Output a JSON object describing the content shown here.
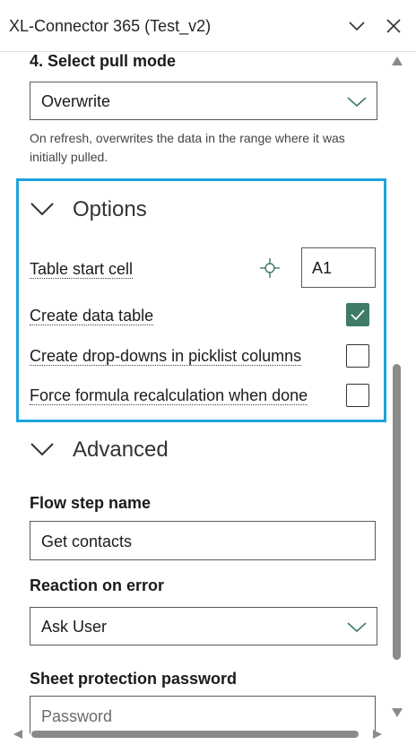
{
  "window": {
    "title": "XL-Connector 365 (Test_v2)"
  },
  "pull_mode": {
    "heading": "4. Select pull mode",
    "selected": "Overwrite",
    "hint": "On refresh, overwrites the data in the range where it was initially pulled."
  },
  "options": {
    "heading": "Options",
    "table_start_cell_label": "Table start cell",
    "table_start_cell_value": "A1",
    "create_data_table_label": "Create data table",
    "create_data_table_checked": true,
    "create_dropdowns_label": "Create drop-downs in picklist columns",
    "create_dropdowns_checked": false,
    "force_recalc_label": "Force formula recalculation when done",
    "force_recalc_checked": false
  },
  "advanced": {
    "heading": "Advanced",
    "flow_step_name_label": "Flow step name",
    "flow_step_name_value": "Get contacts",
    "reaction_on_error_label": "Reaction on error",
    "reaction_on_error_selected": "Ask User",
    "sheet_protection_label": "Sheet protection password",
    "sheet_protection_placeholder": "Password"
  },
  "colors": {
    "accent_border": "#1ea3dd",
    "checkbox_checked": "#3f7b67",
    "chevron_green": "#3f7b67"
  }
}
